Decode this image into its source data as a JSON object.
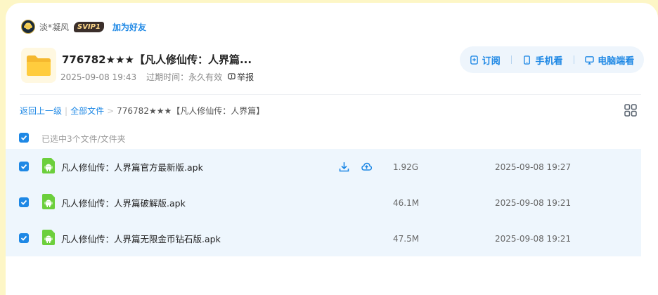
{
  "user": {
    "name": "淡*凝风",
    "badge": "SVIP1",
    "add_friend": "加为好友"
  },
  "folder": {
    "title": "776782★★★【凡人修仙传：人界篇...",
    "created": "2025-09-08 19:43",
    "expiry_label": "过期时间：永久有效",
    "report": "举报"
  },
  "actions": [
    {
      "label": "订阅",
      "icon": "subscribe-icon"
    },
    {
      "label": "手机看",
      "icon": "phone-icon"
    },
    {
      "label": "电脑端看",
      "icon": "monitor-icon"
    }
  ],
  "breadcrumb": {
    "back": "返回上一级",
    "all_files": "全部文件",
    "separator": ">",
    "current": "776782★★★【凡人修仙传：人界篇】"
  },
  "selection": {
    "info": "已选中3个文件/文件夹"
  },
  "files": [
    {
      "name": "凡人修仙传：人界篇官方最新版.apk",
      "size": "1.92G",
      "time": "2025-09-08 19:27",
      "show_actions": true
    },
    {
      "name": "凡人修仙传：人界篇破解版.apk",
      "size": "46.1M",
      "time": "2025-09-08 19:21",
      "show_actions": false
    },
    {
      "name": "凡人修仙传：人界篇无限金币钻石版.apk",
      "size": "47.5M",
      "time": "2025-09-08 19:21",
      "show_actions": false
    }
  ],
  "colors": {
    "accent": "#1e88e5",
    "row_bg": "#eef6fd",
    "page_bg": "#fdf6c6",
    "apk_green": "#6ccf3c"
  }
}
